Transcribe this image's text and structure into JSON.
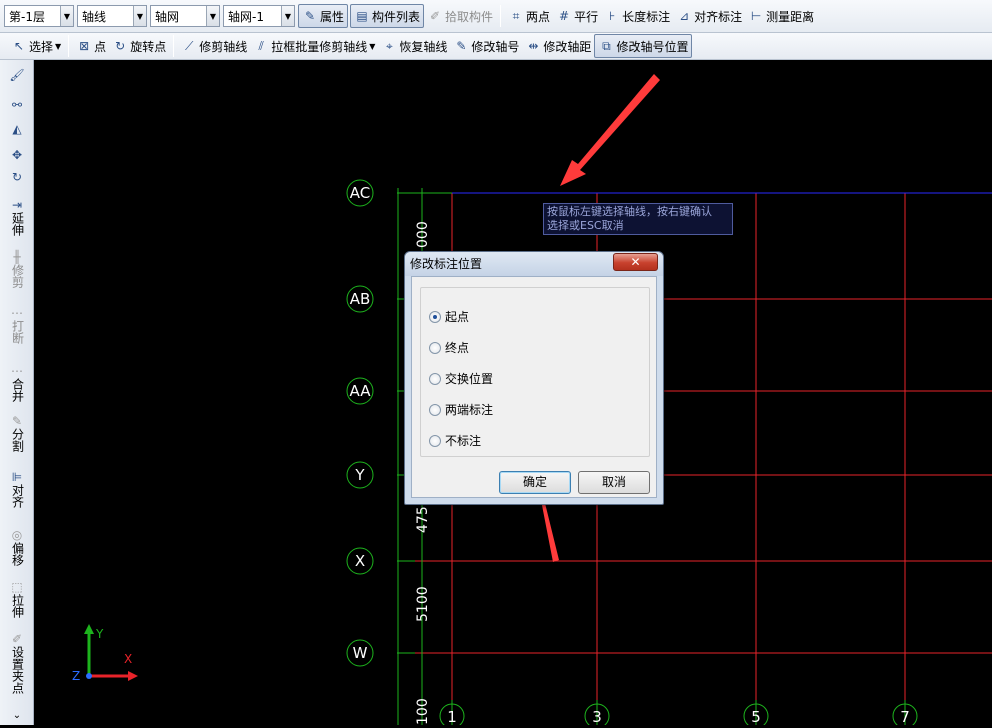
{
  "toolbar1": {
    "floor": "第-1层",
    "category": "轴线",
    "type": "轴网",
    "item": "轴网-1",
    "property": "属性",
    "component_list": "构件列表",
    "pick_component": "拾取构件",
    "two_points": "两点",
    "parallel": "平行",
    "length_dim": "长度标注",
    "align_dim": "对齐标注",
    "measure": "测量距离"
  },
  "toolbar2": {
    "select": "选择",
    "point": "点",
    "rotate_point": "旋转点",
    "trim_axis": "修剪轴线",
    "batch_trim": "拉框批量修剪轴线",
    "restore_axis": "恢复轴线",
    "edit_axis_no": "修改轴号",
    "edit_axis_dist": "修改轴距",
    "edit_axis_pos": "修改轴号位置"
  },
  "left_toolbar": {
    "extend": "延伸",
    "trim": "修剪",
    "break": "打断",
    "merge": "合并",
    "split": "分割",
    "align": "对齐",
    "offset": "偏移",
    "stretch": "拉伸",
    "set_clip": "设置夹点"
  },
  "canvas": {
    "row_labels": [
      "AC",
      "AB",
      "AA",
      "Y",
      "X",
      "W"
    ],
    "col_labels": [
      "1",
      "3",
      "5",
      "7"
    ],
    "dims": [
      "000",
      "475",
      "5100",
      "100"
    ],
    "tooltip_line1": "按鼠标左键选择轴线，按右键确认",
    "tooltip_line2": "选择或ESC取消",
    "ucs_x": "X",
    "ucs_y": "Y",
    "ucs_z": "Z",
    "colors": {
      "grid_red": "#e8232a",
      "axis_green": "#1db31d",
      "highlight_blue": "#2a2aff",
      "arrow_red": "#ff3b3b"
    }
  },
  "dialog": {
    "title": "修改标注位置",
    "close": "✕",
    "options": [
      "起点",
      "终点",
      "交换位置",
      "两端标注",
      "不标注"
    ],
    "selected_index": 0,
    "ok": "确定",
    "cancel": "取消"
  }
}
